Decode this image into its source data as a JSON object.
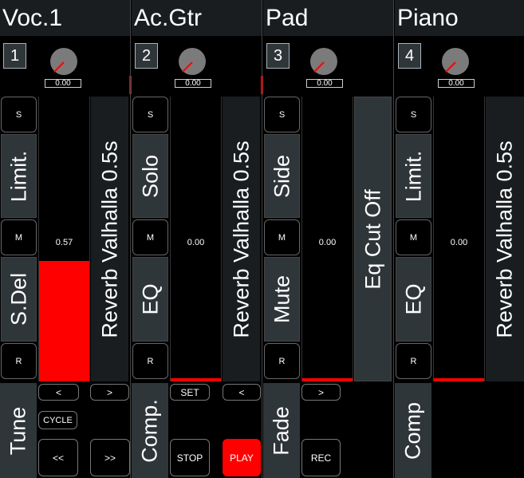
{
  "colors": {
    "accent": "#ff0000",
    "tile": "#2f363a",
    "header": "#1a1d20",
    "background": "#000000"
  },
  "channels": [
    {
      "title": "Voc.1",
      "number": "1",
      "knob_value": "0.00",
      "solo": "S",
      "mute": "M",
      "rec": "R",
      "upper_label": "Limit.",
      "lower_label": "S.Del",
      "fader_value": "0.57",
      "fader_level": 0.57,
      "side_label": "Reverb Valhalla 0.5s"
    },
    {
      "title": "Ac.Gtr",
      "number": "2",
      "knob_value": "0.00",
      "solo": "S",
      "mute": "M",
      "rec": "R",
      "upper_label": "Solo",
      "lower_label": "EQ",
      "fader_value": "0.00",
      "fader_level": 0.0,
      "side_label": "Reverb Valhalla 0.5s"
    },
    {
      "title": "Pad",
      "number": "3",
      "knob_value": "0.00",
      "solo": "S",
      "mute": "M",
      "rec": "R",
      "upper_label": "Side",
      "lower_label": "Mute",
      "fader_value": "0.00",
      "fader_level": 0.0,
      "side_label": "Eq Cut Off"
    },
    {
      "title": "Piano",
      "number": "4",
      "knob_value": "0.00",
      "solo": "S",
      "mute": "M",
      "rec": "R",
      "upper_label": "Limit.",
      "lower_label": "EQ",
      "fader_value": "0.00",
      "fader_level": 0.0,
      "side_label": "Reverb Valhalla 0.5s"
    }
  ],
  "transport": {
    "tile_1": "Tune",
    "tile_2": "Comp.",
    "tile_3": "Fade",
    "tile_4": "Comp",
    "prev_1": "<",
    "next_1": ">",
    "cycle": "CYCLE",
    "rewind": "<<",
    "forward": ">>",
    "set": "SET",
    "prev_2": "<",
    "stop": "STOP",
    "play": "PLAY",
    "next_2": ">",
    "rec": "REC"
  }
}
